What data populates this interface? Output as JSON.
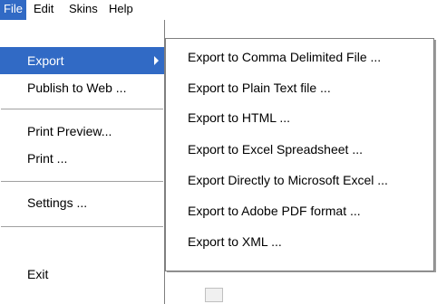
{
  "menubar": {
    "items": [
      {
        "label": "File",
        "active": true
      },
      {
        "label": "Edit"
      },
      {
        "label": "Skins"
      },
      {
        "label": "Help"
      }
    ]
  },
  "file_menu": {
    "items": [
      {
        "label": "Export",
        "has_submenu": true,
        "highlighted": true
      },
      {
        "label": "Publish to Web ..."
      },
      {
        "label": "Print Preview..."
      },
      {
        "label": "Print ..."
      },
      {
        "label": "Settings ..."
      },
      {
        "label": "Exit"
      }
    ]
  },
  "export_submenu": {
    "items": [
      {
        "label": "Export to Comma Delimited File ..."
      },
      {
        "label": "Export to Plain Text file ..."
      },
      {
        "label": "Export to HTML ..."
      },
      {
        "label": "Export to Excel Spreadsheet ..."
      },
      {
        "label": "Export Directly to Microsoft Excel ..."
      },
      {
        "label": "Export to Adobe PDF format ..."
      },
      {
        "label": "Export to XML ..."
      }
    ]
  },
  "colors": {
    "highlight": "#316ac5",
    "highlight_text": "#ffffff",
    "menu_bg": "#ffffff",
    "separator": "#a0a0a0"
  }
}
